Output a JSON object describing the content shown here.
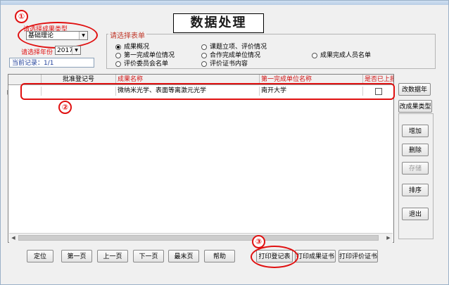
{
  "page_title": "数据处理",
  "annotations": [
    "①",
    "②",
    "③"
  ],
  "type_select": {
    "label": "请选择成果类型",
    "value": "基础理论"
  },
  "year_select": {
    "label": "请选择年份",
    "value": "2017"
  },
  "record": "当前记录：1/1",
  "form_group": {
    "legend": "请选择表单",
    "options": [
      {
        "label": "成果概况",
        "selected": true
      },
      {
        "label": "课题立项、评价情况",
        "selected": false
      },
      {
        "label": "第一完成单位情况",
        "selected": false
      },
      {
        "label": "合作完成单位情况",
        "selected": false
      },
      {
        "label": "成果完成人员名单",
        "selected": false
      },
      {
        "label": "评价委员会名单",
        "selected": false
      },
      {
        "label": "评价证书内容",
        "selected": false
      }
    ]
  },
  "grid": {
    "columns": [
      "批准登记号",
      "成果名称",
      "第一完成单位名称",
      "是否已上报"
    ],
    "rows": [
      {
        "reg_no": "",
        "name": "微纳米光学、表面等离激元光学",
        "unit": "南开大学",
        "reported": false
      }
    ]
  },
  "right_buttons": {
    "change_year": "改数据年",
    "change_type": "改成果类型",
    "add": "增加",
    "delete": "删除",
    "save": "存储",
    "sort": "排序",
    "exit": "退出"
  },
  "bottom_buttons": {
    "locate": "定位",
    "first": "第一页",
    "prev": "上一页",
    "next": "下一页",
    "last": "最末页",
    "help": "帮助",
    "print_register": "打印登记表",
    "print_certificate": "打印成果证书",
    "print_eval": "打印评价证书"
  },
  "colors": {
    "annotation": "#e01010",
    "legend": "#c0392b",
    "record_text": "#1f3f9a"
  },
  "icons": {
    "row_pointer": "hand-pointer-icon"
  }
}
